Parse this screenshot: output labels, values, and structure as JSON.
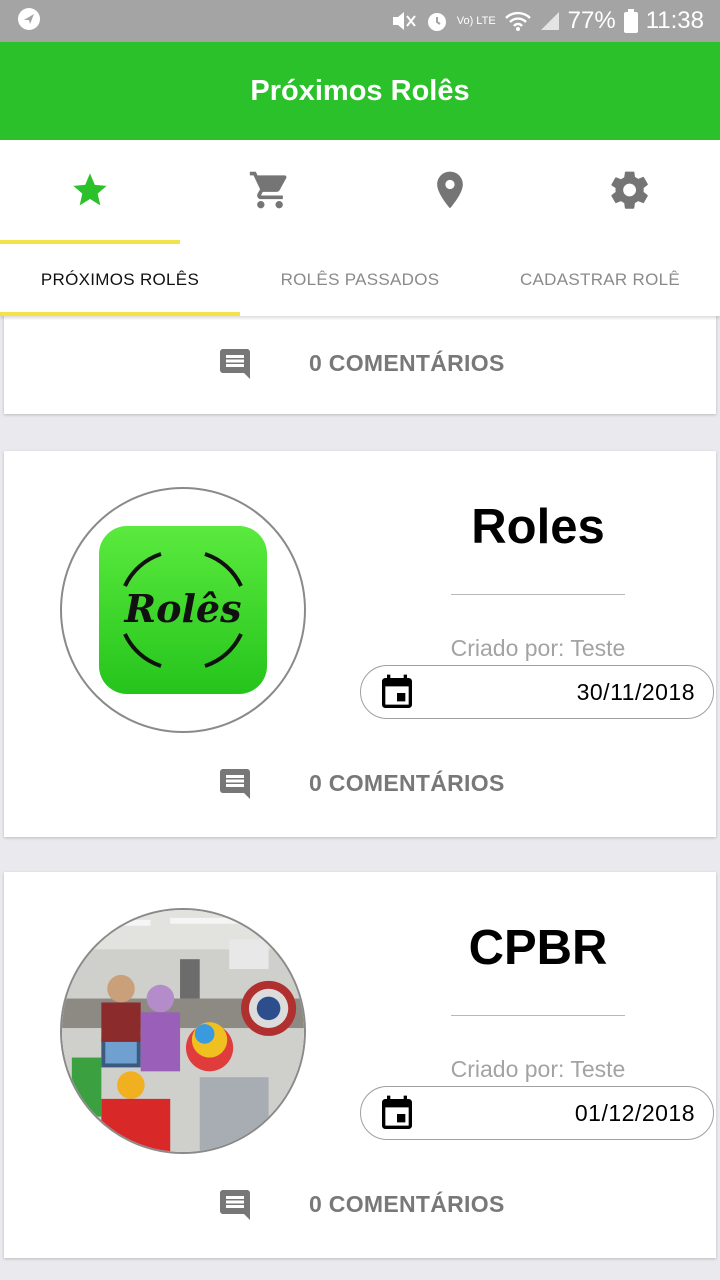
{
  "status_bar": {
    "battery": "77%",
    "time": "11:38",
    "network_label": "Vo) LTE"
  },
  "app_bar": {
    "title": "Próximos Rolês"
  },
  "icon_tabs": [
    {
      "icon": "star-icon",
      "active": true
    },
    {
      "icon": "cart-icon",
      "active": false
    },
    {
      "icon": "location-pin-icon",
      "active": false
    },
    {
      "icon": "gear-icon",
      "active": false
    }
  ],
  "text_tabs": [
    {
      "label": "PRÓXIMOS ROLÊS",
      "active": true
    },
    {
      "label": "ROLÊS PASSADOS",
      "active": false
    },
    {
      "label": "CADASTRAR ROLÊ",
      "active": false
    }
  ],
  "colors": {
    "app_bar": "#2ac12a",
    "tab_indicator": "#f3e349",
    "active_icon": "#2ac12a",
    "inactive_icon": "#757575"
  },
  "events": [
    {
      "comments": "0 COMENTÁRIOS"
    },
    {
      "title": "Roles",
      "creator": "Criado por: Teste",
      "date": "30/11/2018",
      "comments": "0 COMENTÁRIOS",
      "logo_text": "Rolês"
    },
    {
      "title": "CPBR",
      "creator": "Criado por: Teste",
      "date": "01/12/2018",
      "comments": "0 COMENTÁRIOS"
    }
  ]
}
